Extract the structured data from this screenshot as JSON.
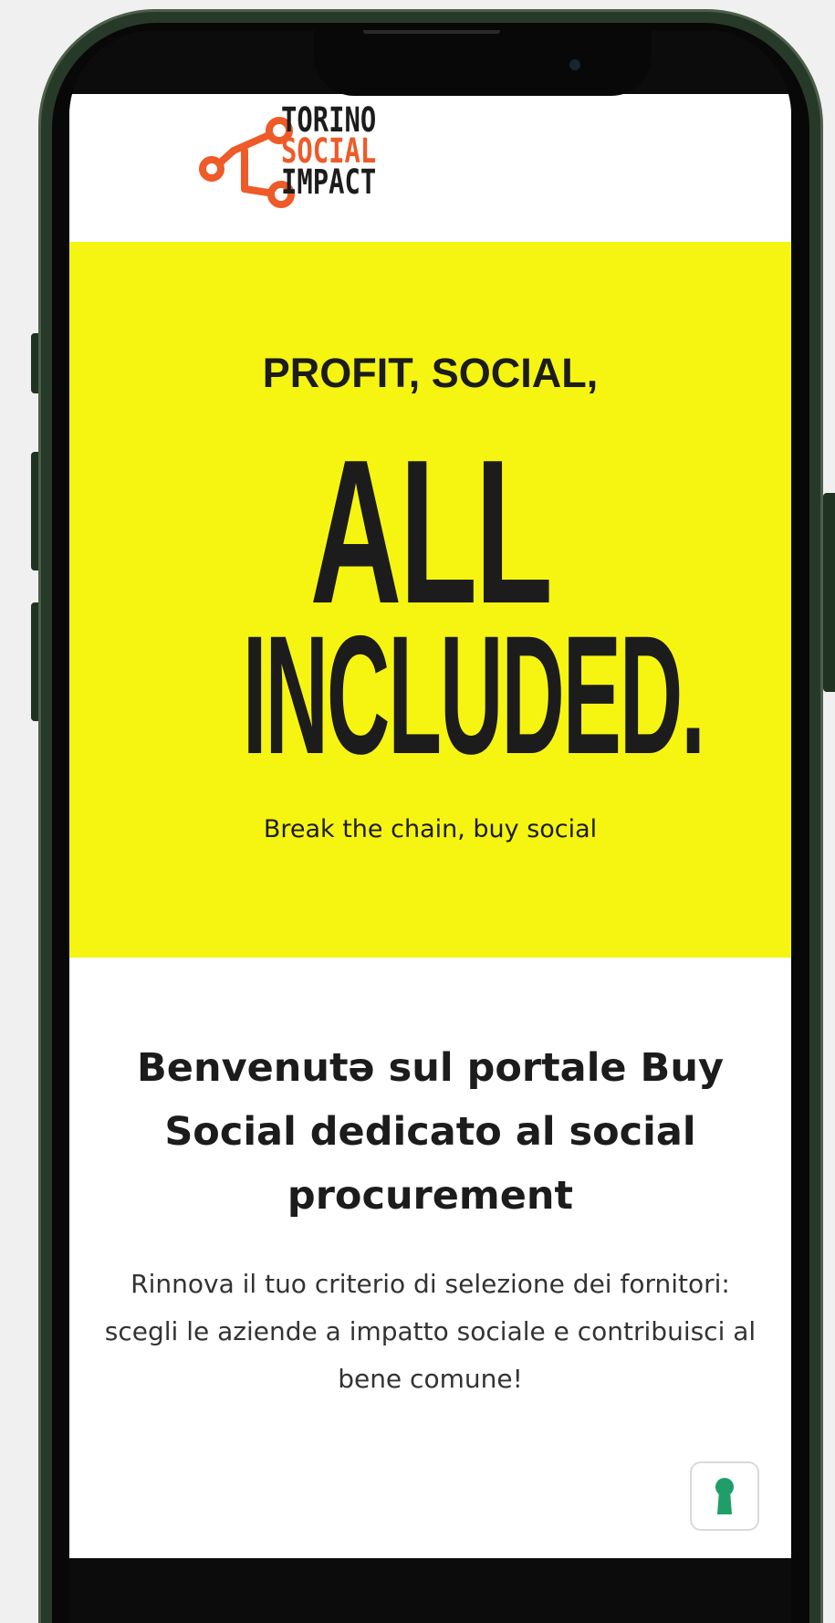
{
  "brand": {
    "logo_lines": [
      "TORINO",
      "SOCIAL",
      "IMPACT"
    ],
    "logo_colors": {
      "orange": "#ee5a28",
      "dark": "#1c1c1c"
    }
  },
  "hero": {
    "kicker": "PROFIT, SOCIAL,",
    "headline_line1": "ALL",
    "headline_line2": "INCLUDED.",
    "tagline": "Break the chain, buy social",
    "background_color": "#f6f511"
  },
  "intro": {
    "heading": "Benvenutə sul portale Buy Social dedicato al social procurement",
    "body": "Rinnova il tuo criterio di selezione dei fornitori: scegli le aziende a impatto sociale e contribuisci al bene comune!"
  },
  "accessibility_widget": {
    "icon": "keyhole-icon",
    "color": "#1f9e6a"
  },
  "device": {
    "frame_color": "#273a29"
  }
}
